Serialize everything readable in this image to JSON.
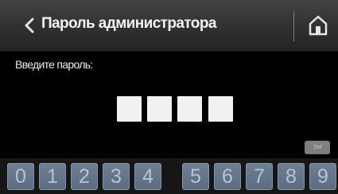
{
  "header": {
    "title": "Пароль администратора",
    "back_icon": "chevron-left-icon",
    "home_icon": "home-icon"
  },
  "prompt": {
    "label": "Введите пароль:"
  },
  "pin": {
    "box_count": 4,
    "entered": 0
  },
  "keypad": {
    "delete_label": "Del",
    "keys": [
      "0",
      "1",
      "2",
      "3",
      "4",
      "5",
      "6",
      "7",
      "8",
      "9"
    ]
  },
  "colors": {
    "background": "#000000",
    "header": "#303030",
    "pin_box": "#f1f1f1",
    "key_fill": "#66768a",
    "key_text": "#b7c4d6"
  }
}
